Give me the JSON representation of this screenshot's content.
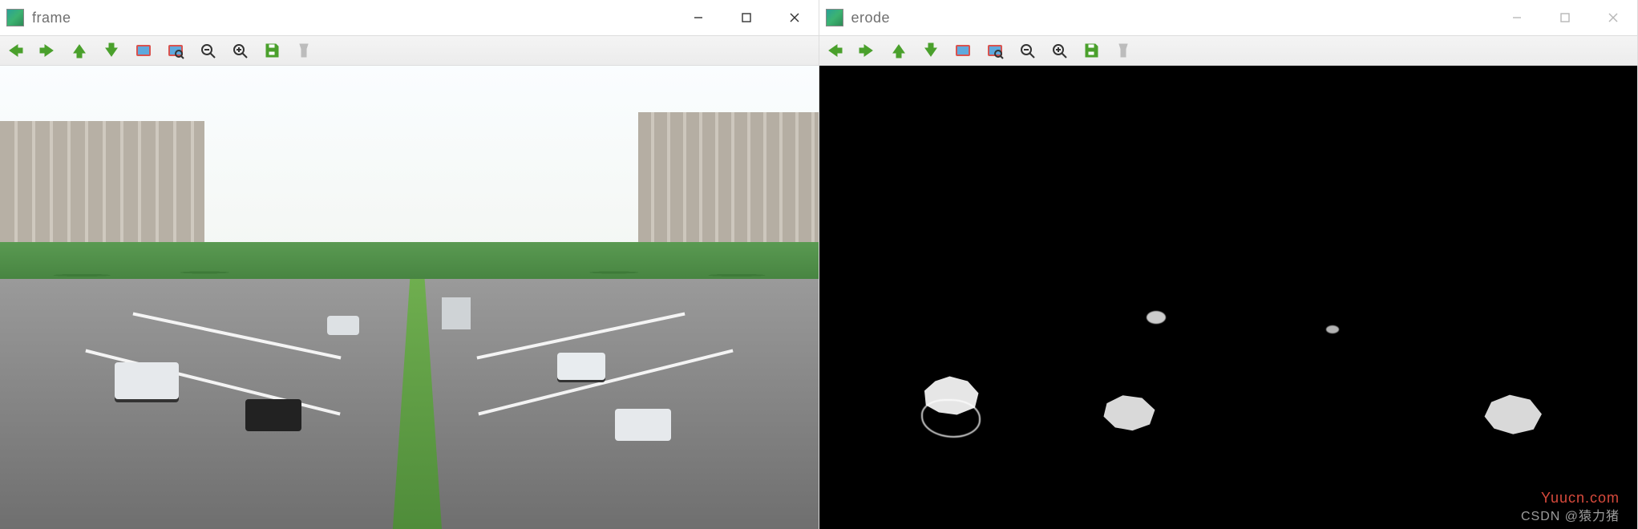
{
  "windows": [
    {
      "key": "frame",
      "title": "frame",
      "active": true,
      "controls": {
        "minimize": "—",
        "maximize": "▢",
        "close": "✕"
      }
    },
    {
      "key": "erode",
      "title": "erode",
      "active": false,
      "controls": {
        "minimize": "—",
        "maximize": "▢",
        "close": "✕"
      }
    }
  ],
  "toolbar": {
    "items": [
      {
        "name": "nav-back-button",
        "icon": "arrow-left-icon",
        "color": "#4aa02c"
      },
      {
        "name": "nav-forward-button",
        "icon": "arrow-right-icon",
        "color": "#4aa02c"
      },
      {
        "name": "nav-up-button",
        "icon": "arrow-up-icon",
        "color": "#4aa02c"
      },
      {
        "name": "nav-down-button",
        "icon": "arrow-down-icon",
        "color": "#4aa02c"
      },
      {
        "name": "roi-button",
        "icon": "roi-rect-icon",
        "color": "#d9534f"
      },
      {
        "name": "roi-zoom-button",
        "icon": "roi-zoom-icon",
        "color": "#d9534f"
      },
      {
        "name": "zoom-out-button",
        "icon": "zoom-out-icon",
        "color": "#333333"
      },
      {
        "name": "zoom-in-button",
        "icon": "zoom-in-icon",
        "color": "#333333"
      },
      {
        "name": "save-button",
        "icon": "save-icon",
        "color": "#4aa02c"
      },
      {
        "name": "properties-button",
        "icon": "flashlight-icon",
        "color": "#bcbcbc"
      }
    ]
  },
  "watermarks": {
    "url": "Yuucn.com",
    "csdn": "CSDN @猿力猪"
  }
}
